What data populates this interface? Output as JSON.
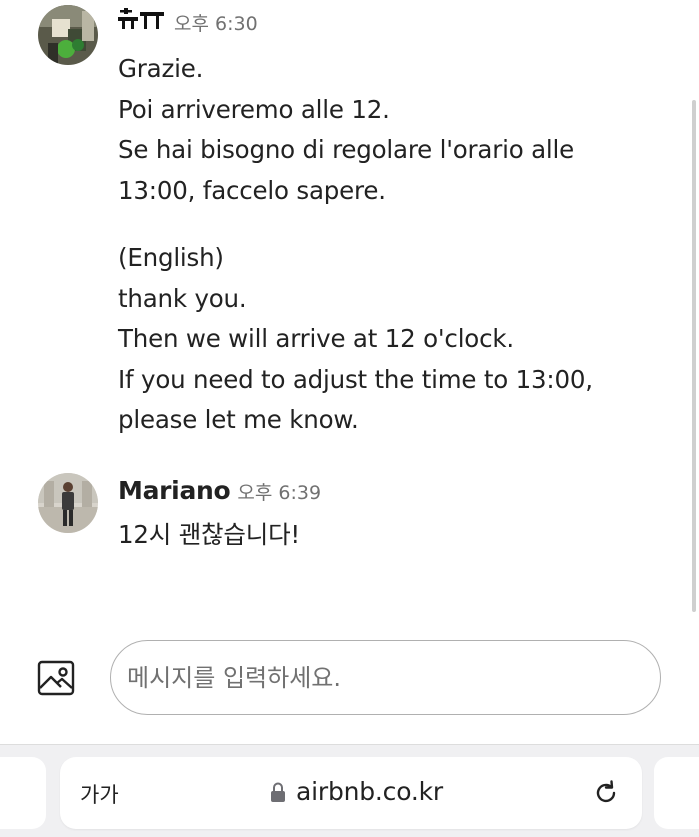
{
  "messages": [
    {
      "sender": "",
      "time": "오후 6:30",
      "paragraphs": [
        [
          "Grazie.",
          "Poi arriveremo alle 12.",
          "Se hai bisogno di regolare l'orario alle",
          "13:00, faccelo sapere."
        ],
        [
          "(English)",
          "thank you.",
          "Then we will arrive at 12 o'clock.",
          "If you need to adjust the time to 13:00,",
          "please let me know."
        ]
      ]
    },
    {
      "sender": "Mariano",
      "time": "오후 6:39",
      "text": "12시 괜찮습니다!"
    }
  ],
  "composer": {
    "placeholder": "메시지를 입력하세요.",
    "attach_icon": "image-icon"
  },
  "browser": {
    "text_size_label": "가가",
    "url": "airbnb.co.kr",
    "lock_icon": "lock-icon",
    "reload_icon": "reload-icon"
  }
}
